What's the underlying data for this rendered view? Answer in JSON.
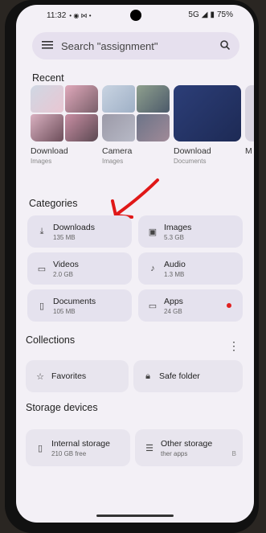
{
  "status": {
    "time": "11:32",
    "icons_left": "• ◉ ⋈ •",
    "network": "5G",
    "battery": "75%"
  },
  "search": {
    "placeholder": "Search \"assignment\""
  },
  "recent": {
    "heading": "Recent",
    "items": [
      {
        "title": "Download",
        "subtitle": "Images"
      },
      {
        "title": "Camera",
        "subtitle": "Images"
      },
      {
        "title": "Download",
        "subtitle": "Documents"
      },
      {
        "title": "M",
        "subtitle": ""
      }
    ]
  },
  "categories": {
    "heading": "Categories",
    "items": [
      {
        "label": "Downloads",
        "size": "135 MB",
        "icon": "download-icon"
      },
      {
        "label": "Images",
        "size": "5.3 GB",
        "icon": "image-icon"
      },
      {
        "label": "Videos",
        "size": "2.0 GB",
        "icon": "video-icon"
      },
      {
        "label": "Audio",
        "size": "1.3 MB",
        "icon": "music-icon"
      },
      {
        "label": "Documents",
        "size": "105 MB",
        "icon": "document-icon"
      },
      {
        "label": "Apps",
        "size": "24 GB",
        "icon": "apps-icon"
      }
    ]
  },
  "collections": {
    "heading": "Collections",
    "items": [
      {
        "label": "Favorites",
        "icon": "star-icon"
      },
      {
        "label": "Safe folder",
        "icon": "lock-icon"
      }
    ]
  },
  "storage": {
    "heading": "Storage devices",
    "items": [
      {
        "label": "Internal storage",
        "sub": "210 GB free",
        "icon": "phone-icon"
      },
      {
        "label": "Other storage",
        "sub": "ther apps",
        "extra": "B",
        "icon": "list-icon"
      }
    ]
  },
  "colors": {
    "accent_dot": "#e02020",
    "arrow": "#e01818"
  }
}
